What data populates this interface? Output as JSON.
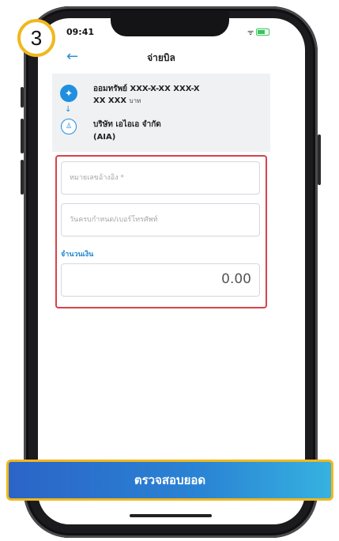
{
  "step": {
    "number": "3"
  },
  "status_bar": {
    "time": "09:41"
  },
  "header": {
    "title": "จ่ายบิล",
    "back_icon": "arrow-left-icon"
  },
  "source": {
    "account": "ออมทรัพย์ XXX-X-XX XXX-X",
    "balance": "XX XXX",
    "currency": "บาท",
    "icon": "bank-logo-icon"
  },
  "biller": {
    "name": "บริษัท เอไอเอ จำกัด",
    "code": "(AIA)",
    "icon": "shield-icon"
  },
  "form": {
    "reference_placeholder": "หมายเลขอ้างอิง *",
    "due_date_placeholder": "วันครบกำหนด/เบอร์โทรศัพท์",
    "amount_label": "จำนวนเงิน",
    "amount_value": "0.00"
  },
  "cta": {
    "label": "ตรวจสอบยอด"
  },
  "colors": {
    "accent": "#1e86cf",
    "highlight": "#f0b81d",
    "outline": "#d8424a"
  }
}
